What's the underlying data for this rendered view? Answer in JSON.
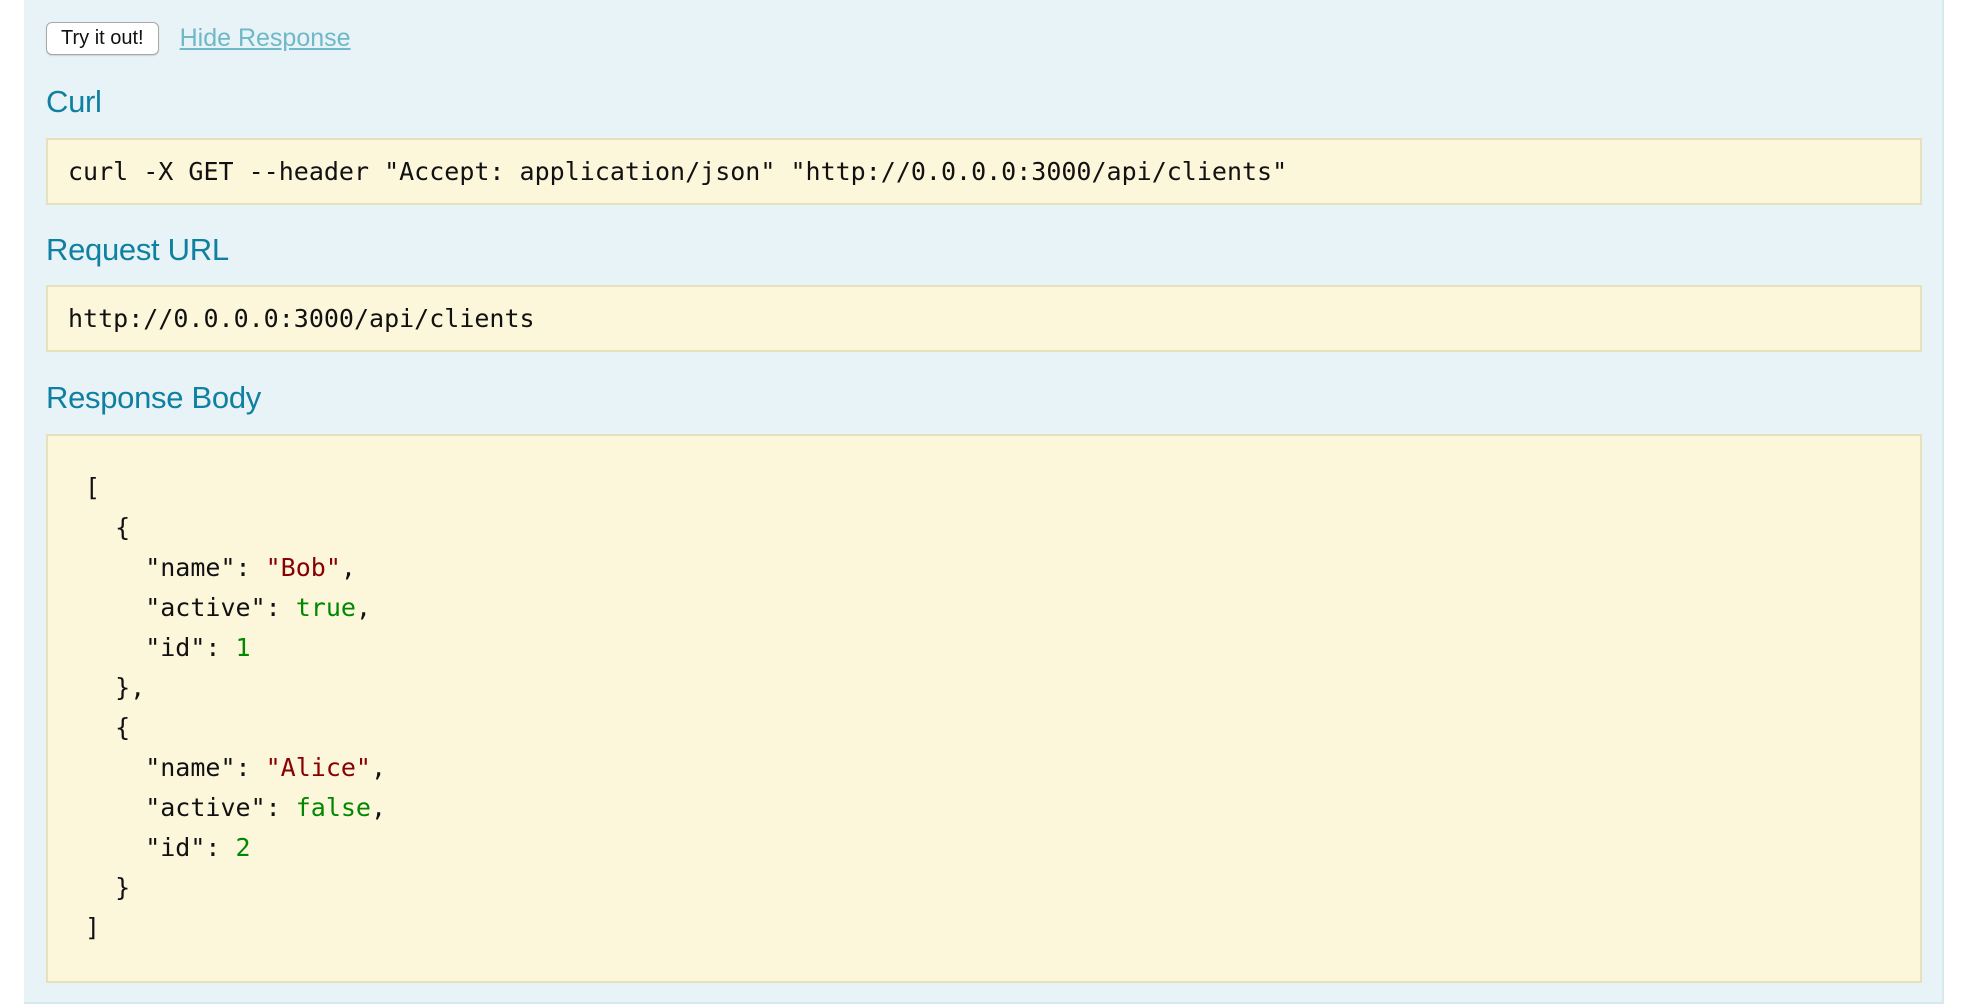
{
  "toolbar": {
    "try_label": "Try it out!",
    "hide_label": "Hide Response"
  },
  "curl": {
    "heading": "Curl",
    "command": "curl -X GET --header \"Accept: application/json\" \"http://0.0.0.0:3000/api/clients\""
  },
  "request_url": {
    "heading": "Request URL",
    "value": "http://0.0.0.0:3000/api/clients"
  },
  "response_body": {
    "heading": "Response Body",
    "items": [
      {
        "name": "Bob",
        "active": true,
        "id": 1
      },
      {
        "name": "Alice",
        "active": false,
        "id": 2
      }
    ]
  },
  "colors": {
    "panel_background": "#e7f3f6",
    "heading": "#0f80a1",
    "link": "#6fb8c8",
    "code_background": "#fcf6db",
    "json_string": "#880000",
    "json_literal": "#008800"
  }
}
